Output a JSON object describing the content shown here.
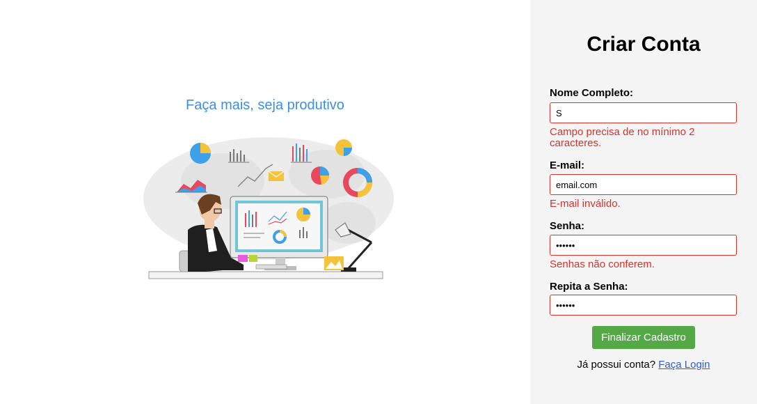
{
  "left": {
    "tagline": "Faça mais, seja produtivo",
    "accent_color": "#3d8fe0"
  },
  "form": {
    "title": "Criar Conta",
    "fields": [
      {
        "label": "Nome Completo:",
        "value": "S",
        "placeholder": "",
        "error": "Campo precisa de no mínimo 2 caracteres."
      },
      {
        "label": "E-mail:",
        "value": "email.com",
        "placeholder": "",
        "error": "E-mail inválido."
      },
      {
        "label": "Senha:",
        "value": "••••••",
        "placeholder": "",
        "error": "Senhas não conferem."
      },
      {
        "label": "Repita a Senha:",
        "value": "••••••",
        "placeholder": ""
      }
    ],
    "submit_label": "Finalizar Cadastro",
    "login_prompt": "Já possui conta?",
    "login_link": "Faça Login",
    "error_color": "#d9322b",
    "button_color": "#54a846"
  }
}
